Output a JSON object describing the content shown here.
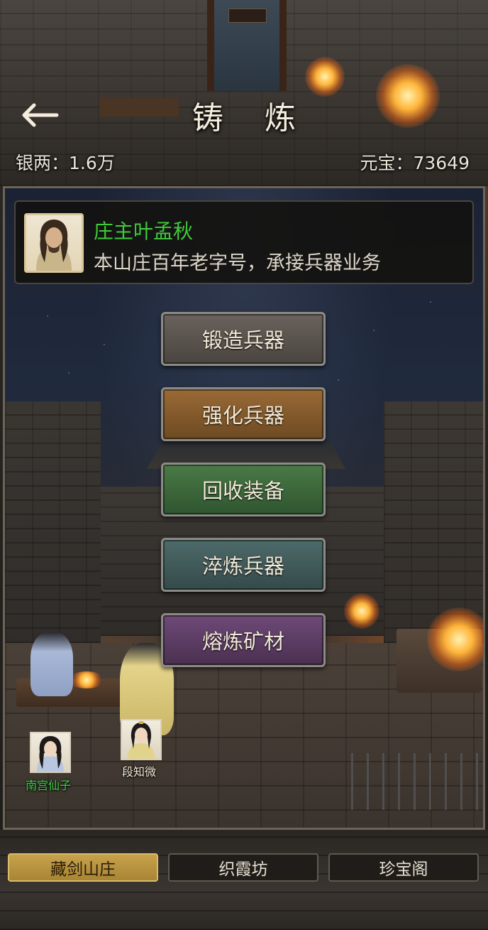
{
  "header": {
    "title": "铸 炼",
    "back_icon": "arrow-left-icon"
  },
  "currency": {
    "silver": "银两：1.6万",
    "ingot": "元宝：73649"
  },
  "npc": {
    "name": "庄主叶孟秋",
    "description": "本山庄百年老字号，承接兵器业务",
    "name_color": "#3fcb3a"
  },
  "menu": {
    "forge": "锻造兵器",
    "enhance": "强化兵器",
    "recycle": "回收装备",
    "temper": "淬炼兵器",
    "smelt": "熔炼矿材"
  },
  "characters": [
    {
      "name": "南宫仙子",
      "color": "#3fd14a"
    },
    {
      "name": "段知微",
      "color": "#f2ead8"
    }
  ],
  "tabs": [
    {
      "label": "藏剑山庄",
      "active": true
    },
    {
      "label": "织霞坊",
      "active": false
    },
    {
      "label": "珍宝阁",
      "active": false
    }
  ],
  "colors": {
    "accent_gold": "#c7a24c",
    "forge_button": "#6a625c",
    "enhance_button": "#9a6a36",
    "recycle_button": "#4a7a46",
    "temper_button": "#4e6a6a",
    "smelt_button": "#6e4a78"
  }
}
